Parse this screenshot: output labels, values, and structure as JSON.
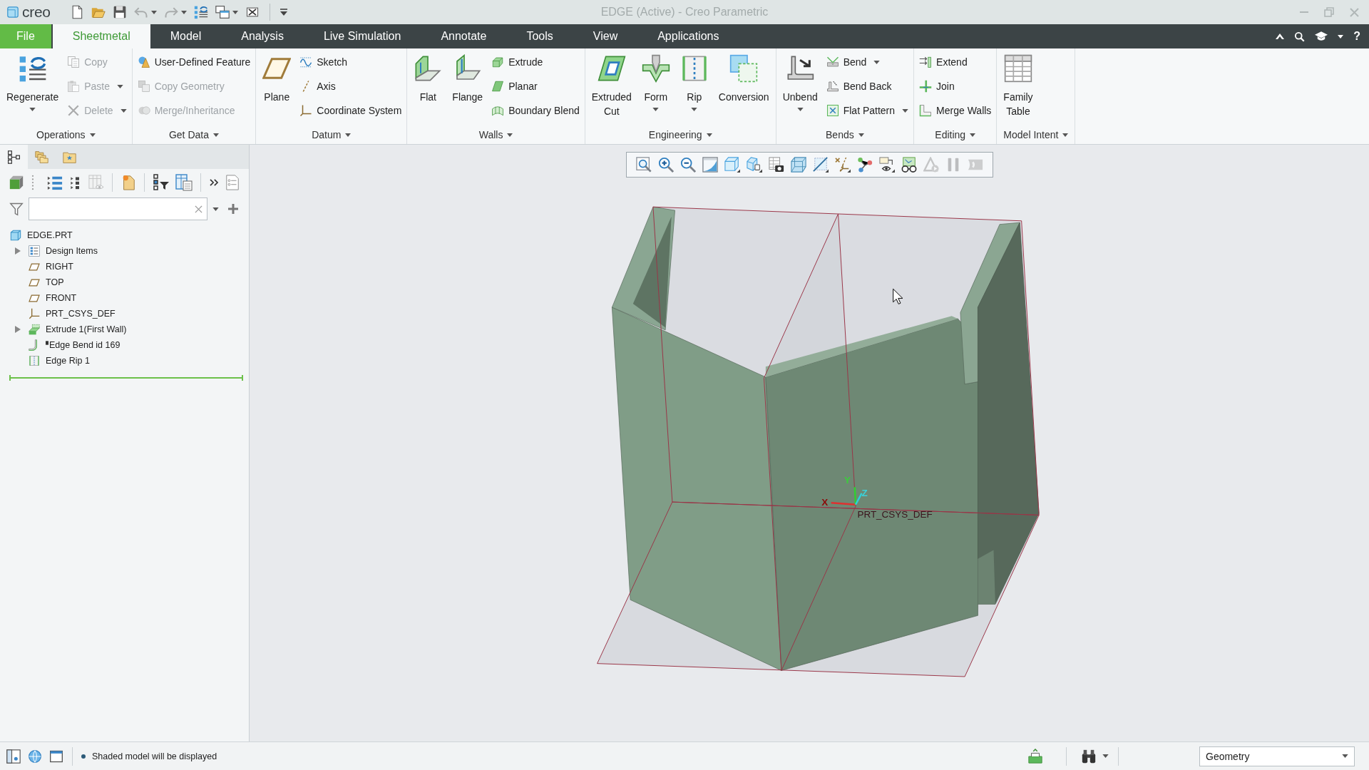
{
  "title_bar": {
    "logo": "creo",
    "quick_access": [
      {
        "disabled": false,
        "dropdown": false
      },
      {
        "disabled": false,
        "dropdown": false
      },
      {
        "disabled": false,
        "dropdown": false
      },
      {
        "disabled": true,
        "dropdown": true
      },
      {
        "disabled": true,
        "dropdown": true
      },
      {
        "disabled": false,
        "dropdown": false
      },
      {
        "disabled": false,
        "dropdown": true
      },
      {
        "disabled": false,
        "dropdown": false
      }
    ],
    "title": "EDGE (Active) - Creo Parametric"
  },
  "menu_bar": {
    "tabs": [
      {
        "label": "File",
        "kind": "file",
        "selected": false
      },
      {
        "label": "Sheetmetal",
        "kind": "tab",
        "selected": true
      },
      {
        "label": "Model",
        "kind": "tab",
        "selected": false
      },
      {
        "label": "Analysis",
        "kind": "tab",
        "selected": false
      },
      {
        "label": "Live Simulation",
        "kind": "tab",
        "selected": false
      },
      {
        "label": "Annotate",
        "kind": "tab",
        "selected": false
      },
      {
        "label": "Tools",
        "kind": "tab",
        "selected": false
      },
      {
        "label": "View",
        "kind": "tab",
        "selected": false
      },
      {
        "label": "Applications",
        "kind": "tab",
        "selected": false
      }
    ],
    "help": "?"
  },
  "ribbon": {
    "groups": [
      {
        "label": "Operations",
        "controls": [
          {
            "kind": "large",
            "label": "Regenerate",
            "disabled": false,
            "dropdown": true
          },
          {
            "kind": "stack",
            "items": [
              {
                "label": "Copy",
                "disabled": true,
                "dropdown": false
              },
              {
                "label": "Paste",
                "disabled": true,
                "dropdown": true
              },
              {
                "label": "Delete",
                "disabled": true,
                "dropdown": true
              }
            ]
          }
        ]
      },
      {
        "label": "Get Data",
        "controls": [
          {
            "kind": "stack",
            "items": [
              {
                "label": "User-Defined Feature",
                "disabled": false,
                "dropdown": false
              },
              {
                "label": "Copy Geometry",
                "disabled": true,
                "dropdown": false
              },
              {
                "label": "Merge/Inheritance",
                "disabled": true,
                "dropdown": false
              }
            ]
          }
        ]
      },
      {
        "label": "Datum",
        "controls": [
          {
            "kind": "large",
            "label": "Plane",
            "disabled": false,
            "dropdown": false
          },
          {
            "kind": "stack",
            "items": [
              {
                "label": "Sketch",
                "disabled": false,
                "dropdown": false
              },
              {
                "label": "Axis",
                "disabled": false,
                "dropdown": false
              },
              {
                "label": "Coordinate System",
                "disabled": false,
                "dropdown": false
              }
            ]
          }
        ]
      },
      {
        "label": "Walls",
        "controls": [
          {
            "kind": "large",
            "label": "Flat",
            "disabled": false,
            "dropdown": false
          },
          {
            "kind": "large",
            "label": "Flange",
            "disabled": false,
            "dropdown": false
          },
          {
            "kind": "stack",
            "items": [
              {
                "label": "Extrude",
                "disabled": false,
                "dropdown": false
              },
              {
                "label": "Planar",
                "disabled": false,
                "dropdown": false
              },
              {
                "label": "Boundary Blend",
                "disabled": false,
                "dropdown": false
              }
            ]
          }
        ]
      },
      {
        "label": "Engineering",
        "controls": [
          {
            "kind": "large",
            "label": "Extruded Cut",
            "disabled": false,
            "dropdown": false
          },
          {
            "kind": "large",
            "label": "Form",
            "disabled": false,
            "dropdown": true
          },
          {
            "kind": "large",
            "label": "Rip",
            "disabled": false,
            "dropdown": true
          },
          {
            "kind": "large",
            "label": "Conversion",
            "disabled": false,
            "dropdown": false
          }
        ]
      },
      {
        "label": "Bends",
        "controls": [
          {
            "kind": "large",
            "label": "Unbend",
            "disabled": false,
            "dropdown": true
          },
          {
            "kind": "stack",
            "items": [
              {
                "label": "Bend",
                "disabled": false,
                "dropdown": true
              },
              {
                "label": "Bend Back",
                "disabled": false,
                "dropdown": false
              },
              {
                "label": "Flat Pattern",
                "disabled": false,
                "dropdown": true
              }
            ]
          }
        ]
      },
      {
        "label": "Editing",
        "controls": [
          {
            "kind": "stack",
            "items": [
              {
                "label": "Extend",
                "disabled": false,
                "dropdown": false
              },
              {
                "label": "Join",
                "disabled": false,
                "dropdown": false
              },
              {
                "label": "Merge Walls",
                "disabled": false,
                "dropdown": false
              }
            ]
          }
        ]
      },
      {
        "label": "Model Intent",
        "controls": [
          {
            "kind": "large",
            "label": "Family Table",
            "disabled": false,
            "dropdown": false
          }
        ]
      }
    ]
  },
  "model_tree": {
    "panel_tabs": [
      {
        "selected": true
      },
      {
        "selected": false
      },
      {
        "selected": false
      }
    ],
    "toolbar": [
      {
        "disabled": false
      },
      {
        "disabled": false
      },
      {
        "disabled": false
      },
      {
        "disabled": true
      },
      {
        "disabled": false
      },
      {
        "disabled": false
      },
      {
        "disabled": false
      },
      {
        "disabled": false
      },
      {
        "disabled": false
      }
    ],
    "root": {
      "label": "EDGE.PRT",
      "children": [
        {
          "label": "Design Items",
          "expanded": false,
          "marked": false
        },
        {
          "label": "RIGHT",
          "marked": false
        },
        {
          "label": "TOP",
          "marked": false
        },
        {
          "label": "FRONT",
          "marked": false
        },
        {
          "label": "PRT_CSYS_DEF",
          "marked": false
        },
        {
          "label": "Extrude 1(First Wall)",
          "expanded": false,
          "marked": false
        },
        {
          "label": "Edge Bend id 169",
          "marked": true
        },
        {
          "label": "Edge Rip 1",
          "marked": false
        }
      ]
    }
  },
  "viewport": {
    "view_toolbar": [
      {
        "disabled": false
      },
      {
        "disabled": false
      },
      {
        "disabled": false
      },
      {
        "disabled": false
      },
      {
        "disabled": false
      },
      {
        "disabled": false
      },
      {
        "disabled": false
      },
      {
        "disabled": false
      },
      {
        "disabled": false
      },
      {
        "disabled": false
      },
      {
        "disabled": false
      },
      {
        "disabled": false
      },
      {
        "disabled": false
      },
      {
        "disabled": true
      },
      {
        "disabled": true
      },
      {
        "disabled": true
      }
    ],
    "axis_labels": [
      {
        "label": "X",
        "color": "#8c0a0a"
      },
      {
        "label": "Y",
        "color": "#3ccc3c"
      },
      {
        "label": "Z",
        "color": "#3ed0d8"
      }
    ],
    "csys_label": "PRT_CSYS_DEF"
  },
  "status_bar": {
    "message": "Shaded model will be displayed",
    "selection_filter": "Geometry"
  }
}
